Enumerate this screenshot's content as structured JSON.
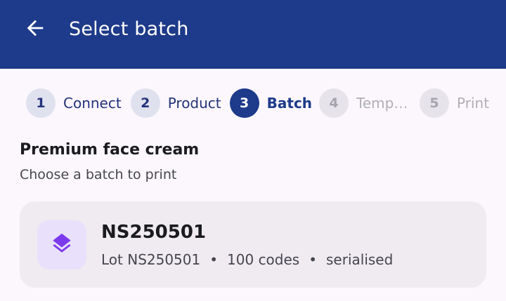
{
  "app_bar": {
    "title": "Select batch",
    "back_icon": "arrow-left-icon",
    "color": "#1e3a8a"
  },
  "stepper": {
    "steps": [
      {
        "number": "1",
        "label": "Connect",
        "state": "done"
      },
      {
        "number": "2",
        "label": "Product",
        "state": "done"
      },
      {
        "number": "3",
        "label": "Batch",
        "state": "current"
      },
      {
        "number": "4",
        "label": "Templ…",
        "state": "todo"
      },
      {
        "number": "5",
        "label": "Print",
        "state": "todo"
      }
    ]
  },
  "product": {
    "title": "Premium face cream",
    "subtitle": "Choose a batch to print"
  },
  "batches": [
    {
      "name": "NS250501",
      "lot": "Lot NS250501",
      "separator": "•",
      "codes": "100 codes",
      "mode": "serialised",
      "icon": "layers-icon",
      "icon_color": "#7c3aed"
    }
  ]
}
